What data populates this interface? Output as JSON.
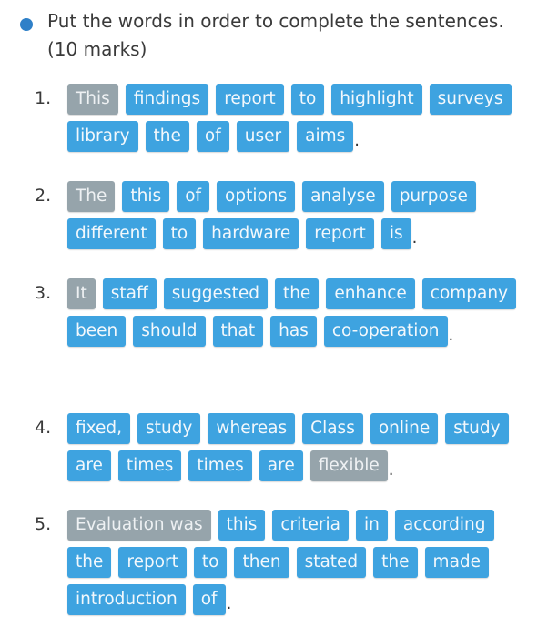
{
  "instruction": {
    "bullet_color": "#2f80c8",
    "text_line1": "Put the words in order to complete the sentences.",
    "text_line2": "(10 marks)"
  },
  "colors": {
    "tile_blue": "#3ea3e0",
    "tile_gray": "#96a4ab"
  },
  "questions": [
    {
      "number": "1.",
      "tiles": [
        {
          "word": "This",
          "fixed": true
        },
        {
          "word": "findings",
          "fixed": false
        },
        {
          "word": "report",
          "fixed": false
        },
        {
          "word": "to",
          "fixed": false
        },
        {
          "word": "highlight",
          "fixed": false
        },
        {
          "word": "surveys",
          "fixed": false
        },
        {
          "word": "library",
          "fixed": false
        },
        {
          "word": "the",
          "fixed": false
        },
        {
          "word": "of",
          "fixed": false
        },
        {
          "word": "user",
          "fixed": false
        },
        {
          "word": "aims",
          "fixed": false
        }
      ],
      "end_punct": "."
    },
    {
      "number": "2.",
      "tiles": [
        {
          "word": "The",
          "fixed": true
        },
        {
          "word": "this",
          "fixed": false
        },
        {
          "word": "of",
          "fixed": false
        },
        {
          "word": "options",
          "fixed": false
        },
        {
          "word": "analyse",
          "fixed": false
        },
        {
          "word": "purpose",
          "fixed": false
        },
        {
          "word": "different",
          "fixed": false
        },
        {
          "word": "to",
          "fixed": false
        },
        {
          "word": "hardware",
          "fixed": false
        },
        {
          "word": "report",
          "fixed": false
        },
        {
          "word": "is",
          "fixed": false
        }
      ],
      "end_punct": "."
    },
    {
      "number": "3.",
      "tiles": [
        {
          "word": "It",
          "fixed": true
        },
        {
          "word": "staff",
          "fixed": false
        },
        {
          "word": "suggested",
          "fixed": false
        },
        {
          "word": "the",
          "fixed": false
        },
        {
          "word": "enhance",
          "fixed": false
        },
        {
          "word": "company",
          "fixed": false
        },
        {
          "word": "been",
          "fixed": false
        },
        {
          "word": "should",
          "fixed": false
        },
        {
          "word": "that",
          "fixed": false
        },
        {
          "word": "has",
          "fixed": false
        },
        {
          "word": "co-operation",
          "fixed": false
        }
      ],
      "end_punct": "."
    },
    {
      "number": "4.",
      "tiles": [
        {
          "word": "fixed,",
          "fixed": false
        },
        {
          "word": "study",
          "fixed": false
        },
        {
          "word": "whereas",
          "fixed": false
        },
        {
          "word": "Class",
          "fixed": false
        },
        {
          "word": "online",
          "fixed": false
        },
        {
          "word": "study",
          "fixed": false
        },
        {
          "word": "are",
          "fixed": false
        },
        {
          "word": "times",
          "fixed": false
        },
        {
          "word": "times",
          "fixed": false
        },
        {
          "word": "are",
          "fixed": false
        },
        {
          "word": "flexible",
          "fixed": true
        }
      ],
      "end_punct": "."
    },
    {
      "number": "5.",
      "tiles": [
        {
          "word": "Evaluation was",
          "fixed": true
        },
        {
          "word": "this",
          "fixed": false
        },
        {
          "word": "criteria",
          "fixed": false
        },
        {
          "word": "in",
          "fixed": false
        },
        {
          "word": "according",
          "fixed": false
        },
        {
          "word": "the",
          "fixed": false
        },
        {
          "word": "report",
          "fixed": false
        },
        {
          "word": "to",
          "fixed": false
        },
        {
          "word": "then",
          "fixed": false
        },
        {
          "word": "stated",
          "fixed": false
        },
        {
          "word": "the",
          "fixed": false
        },
        {
          "word": "made",
          "fixed": false
        },
        {
          "word": "introduction",
          "fixed": false
        },
        {
          "word": "of",
          "fixed": false
        }
      ],
      "end_punct": "."
    }
  ]
}
